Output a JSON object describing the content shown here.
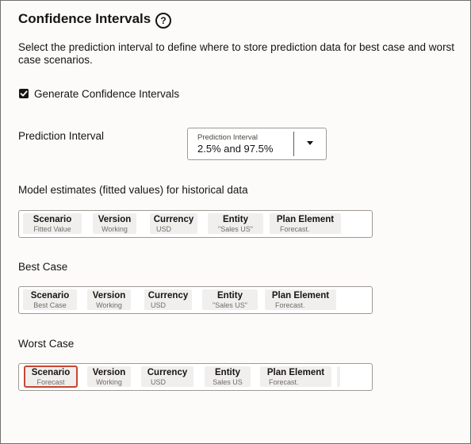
{
  "section": {
    "title": "Confidence Intervals",
    "help_icon": "?",
    "description": "Select the prediction interval to define where to store prediction data for best case and worst case scenarios."
  },
  "generate": {
    "checked": true,
    "label": "Generate Confidence Intervals"
  },
  "prediction_interval": {
    "label": "Prediction Interval",
    "select_label": "Prediction Interval",
    "value": "2.5% and 97.5%"
  },
  "groups": [
    {
      "label": "Model estimates (fitted values) for historical data",
      "chips": [
        {
          "name": "Scenario",
          "value": "Fitted Value"
        },
        {
          "name": "Version",
          "value": "Working"
        },
        {
          "name": "Currency",
          "value": "USD"
        },
        {
          "name": "Entity",
          "value": "\"Sales US\""
        },
        {
          "name": "Plan Element",
          "value": "Forecast."
        }
      ]
    },
    {
      "label": "Best Case",
      "chips": [
        {
          "name": "Scenario",
          "value": "Best Case"
        },
        {
          "name": "Version",
          "value": "Working"
        },
        {
          "name": "Currency",
          "value": "USD"
        },
        {
          "name": "Entity",
          "value": "\"Sales US\""
        },
        {
          "name": "Plan Element",
          "value": "Forecast."
        }
      ]
    },
    {
      "label": "Worst Case",
      "chips": [
        {
          "name": "Scenario",
          "value": "Forecast"
        },
        {
          "name": "Version",
          "value": "Working"
        },
        {
          "name": "Currency",
          "value": "USD"
        },
        {
          "name": "Entity",
          "value": "Sales US"
        },
        {
          "name": "Plan Element",
          "value": "Forecast."
        }
      ]
    }
  ],
  "colors": {
    "focus_outline": "#c74634",
    "chip_background": "#f1efed"
  }
}
